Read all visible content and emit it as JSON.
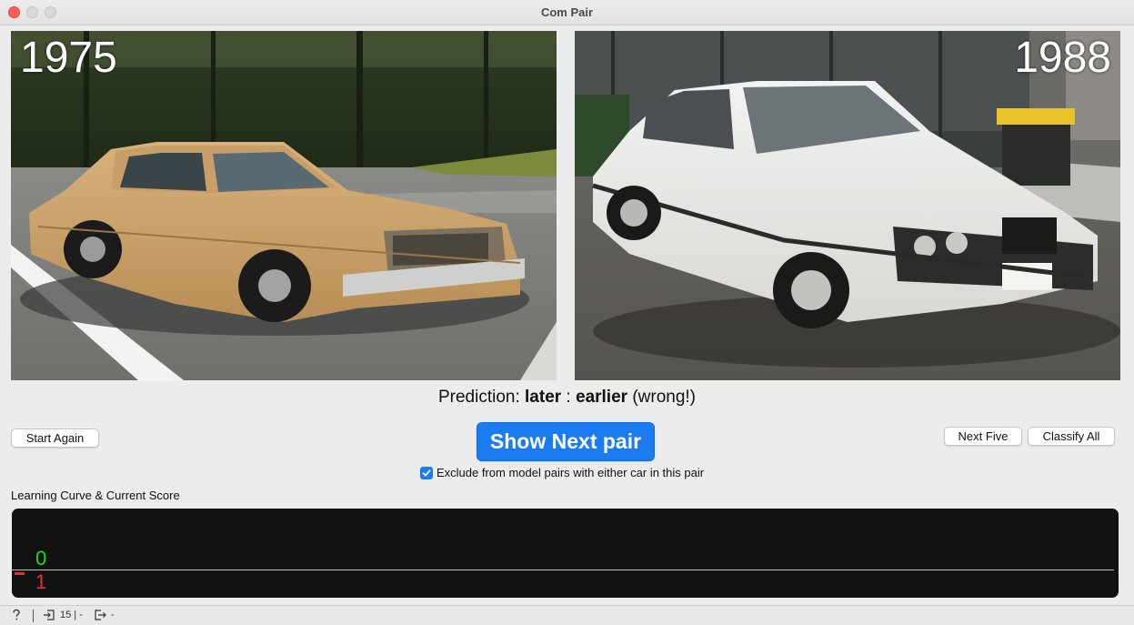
{
  "window": {
    "title": "Com Pair"
  },
  "left_image": {
    "year": "1975"
  },
  "right_image": {
    "year": "1988"
  },
  "prediction": {
    "prefix": "Prediction: ",
    "first": "later",
    "separator": " : ",
    "second": "earlier",
    "verdict": " (wrong!)"
  },
  "buttons": {
    "start_again": "Start Again",
    "show_next_pair": "Show Next pair",
    "next_five": "Next Five",
    "classify_all": "Classify All"
  },
  "exclude_option": {
    "label": "Exclude from model pairs with either car in this pair",
    "checked": true
  },
  "learning_curve": {
    "label": "Learning Curve & Current Score",
    "correct": "0",
    "wrong": "1"
  },
  "statusbar": {
    "help_icon": "question-icon",
    "input_count": "15 | -",
    "output_count": "-"
  },
  "colors": {
    "accent": "#1a7cf0",
    "correct": "#22d622",
    "wrong": "#f02a2a",
    "panel": "#121212"
  }
}
